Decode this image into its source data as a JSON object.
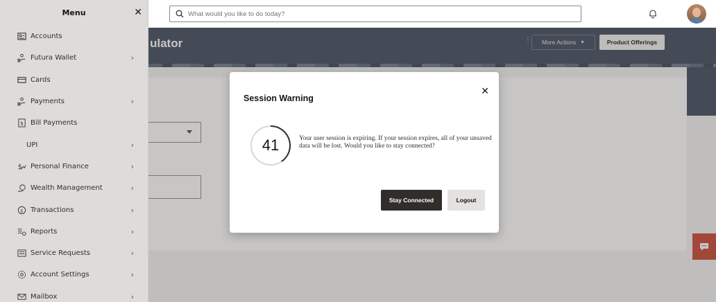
{
  "menu": {
    "title": "Menu",
    "items": [
      {
        "label": "Accounts",
        "icon": "accounts-icon",
        "chevron": false
      },
      {
        "label": "Futura Wallet",
        "icon": "wallet-icon",
        "chevron": true
      },
      {
        "label": "Cards",
        "icon": "card-icon",
        "chevron": false
      },
      {
        "label": "Payments",
        "icon": "payments-icon",
        "chevron": true
      },
      {
        "label": "Bill Payments",
        "icon": "bill-icon",
        "chevron": false
      },
      {
        "label": "UPI",
        "icon": "",
        "chevron": true
      },
      {
        "label": "Personal Finance",
        "icon": "finance-icon",
        "chevron": true
      },
      {
        "label": "Wealth Management",
        "icon": "wealth-icon",
        "chevron": true
      },
      {
        "label": "Transactions",
        "icon": "transactions-icon",
        "chevron": true
      },
      {
        "label": "Reports",
        "icon": "reports-icon",
        "chevron": true
      },
      {
        "label": "Service Requests",
        "icon": "service-icon",
        "chevron": true
      },
      {
        "label": "Account Settings",
        "icon": "settings-icon",
        "chevron": true
      },
      {
        "label": "Mailbox",
        "icon": "mail-icon",
        "chevron": true
      }
    ]
  },
  "search": {
    "placeholder": "What would you like to do today?"
  },
  "banner": {
    "title": "ulator",
    "more_actions": "More Actions",
    "product_offerings": "Product Offerings"
  },
  "dialog": {
    "title": "Session Warning",
    "countdown": "41",
    "message": "Your user session is expiring. If your session expires, all of your unsaved data will be lost. Would you like to stay connected?",
    "stay_label": "Stay Connected",
    "logout_label": "Logout"
  },
  "colors": {
    "accent": "#c74634",
    "banner": "#404b5c",
    "primary_button": "#312d2a"
  }
}
